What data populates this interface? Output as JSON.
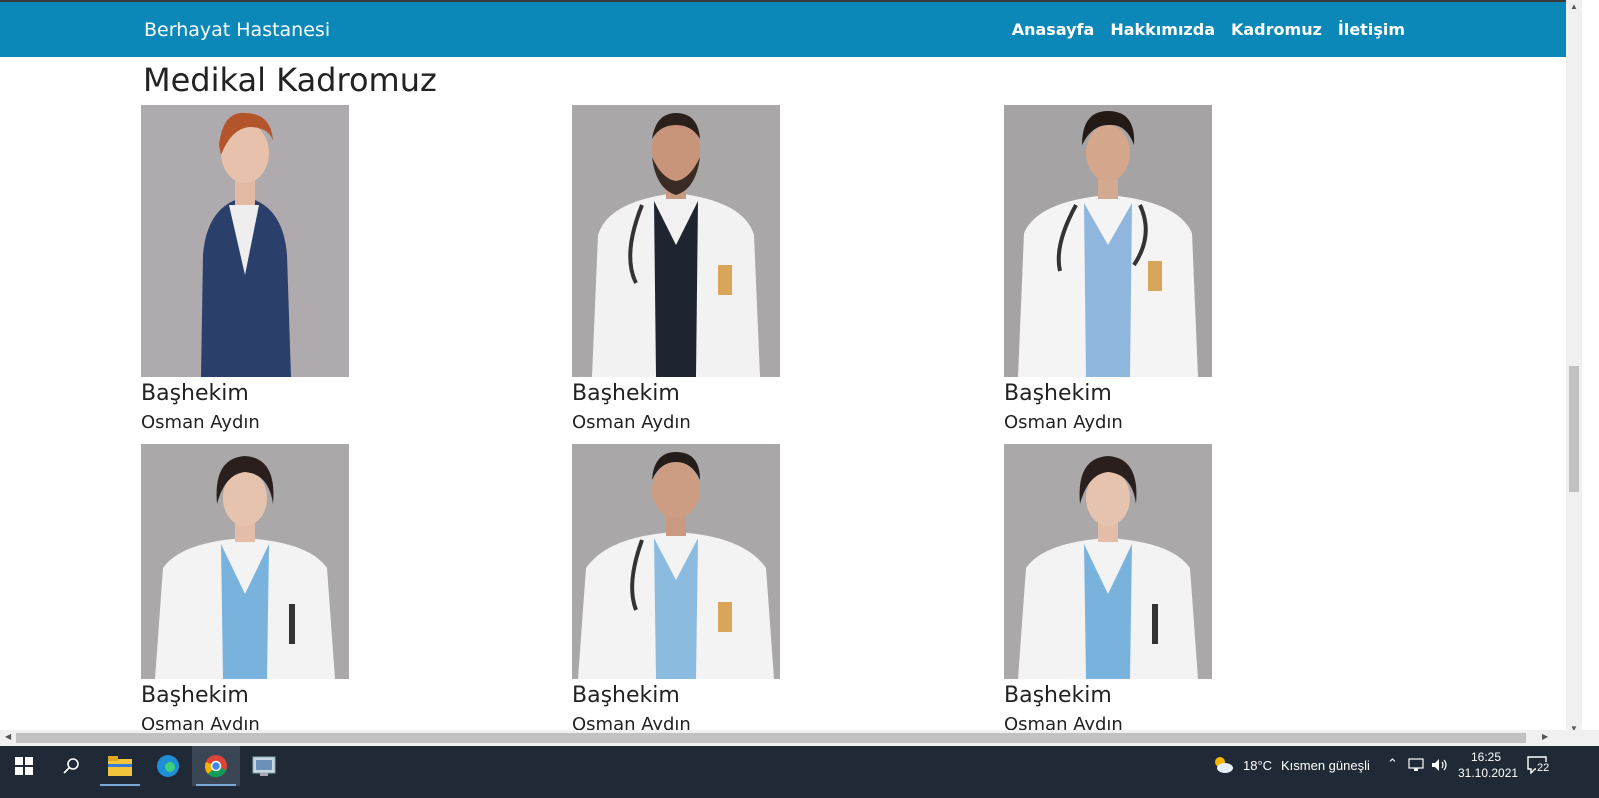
{
  "navbar": {
    "brand": "Berhayat Hastanesi",
    "links": [
      "Anasayfa",
      "Hakkımızda",
      "Kadromuz",
      "İletişim"
    ]
  },
  "page": {
    "heading": "Medikal Kadromuz"
  },
  "staff": [
    {
      "title": "Başhekim",
      "name": "Osman Aydın",
      "outfit": "navy-blazer"
    },
    {
      "title": "Başhekim",
      "name": "Osman Aydın",
      "outfit": "white-coat-dark-scrubs"
    },
    {
      "title": "Başhekim",
      "name": "Osman Aydın",
      "outfit": "white-coat-blue-scrubs"
    },
    {
      "title": "Başhekim",
      "name": "Osman Aydın",
      "outfit": "white-coat-blue-scrubs"
    },
    {
      "title": "Başhekim",
      "name": "Osman Aydın",
      "outfit": "white-coat-blue-scrubs"
    },
    {
      "title": "Başhekim",
      "name": "Osman Aydın",
      "outfit": "white-coat-blue-scrubs"
    }
  ],
  "taskbar": {
    "weather": "18°C",
    "weather_desc": "Kısmen güneşli",
    "time": "16:25",
    "date": "31.10.2021",
    "notifications": "22",
    "icons": [
      "windows-start-icon",
      "search-icon",
      "file-explorer-icon",
      "edge-icon",
      "chrome-icon",
      "app-icon"
    ]
  },
  "colors": {
    "navbar_bg": "#0b88b8",
    "photo_bg": "#a9a6a8",
    "taskbar_bg": "#1f2a36"
  }
}
